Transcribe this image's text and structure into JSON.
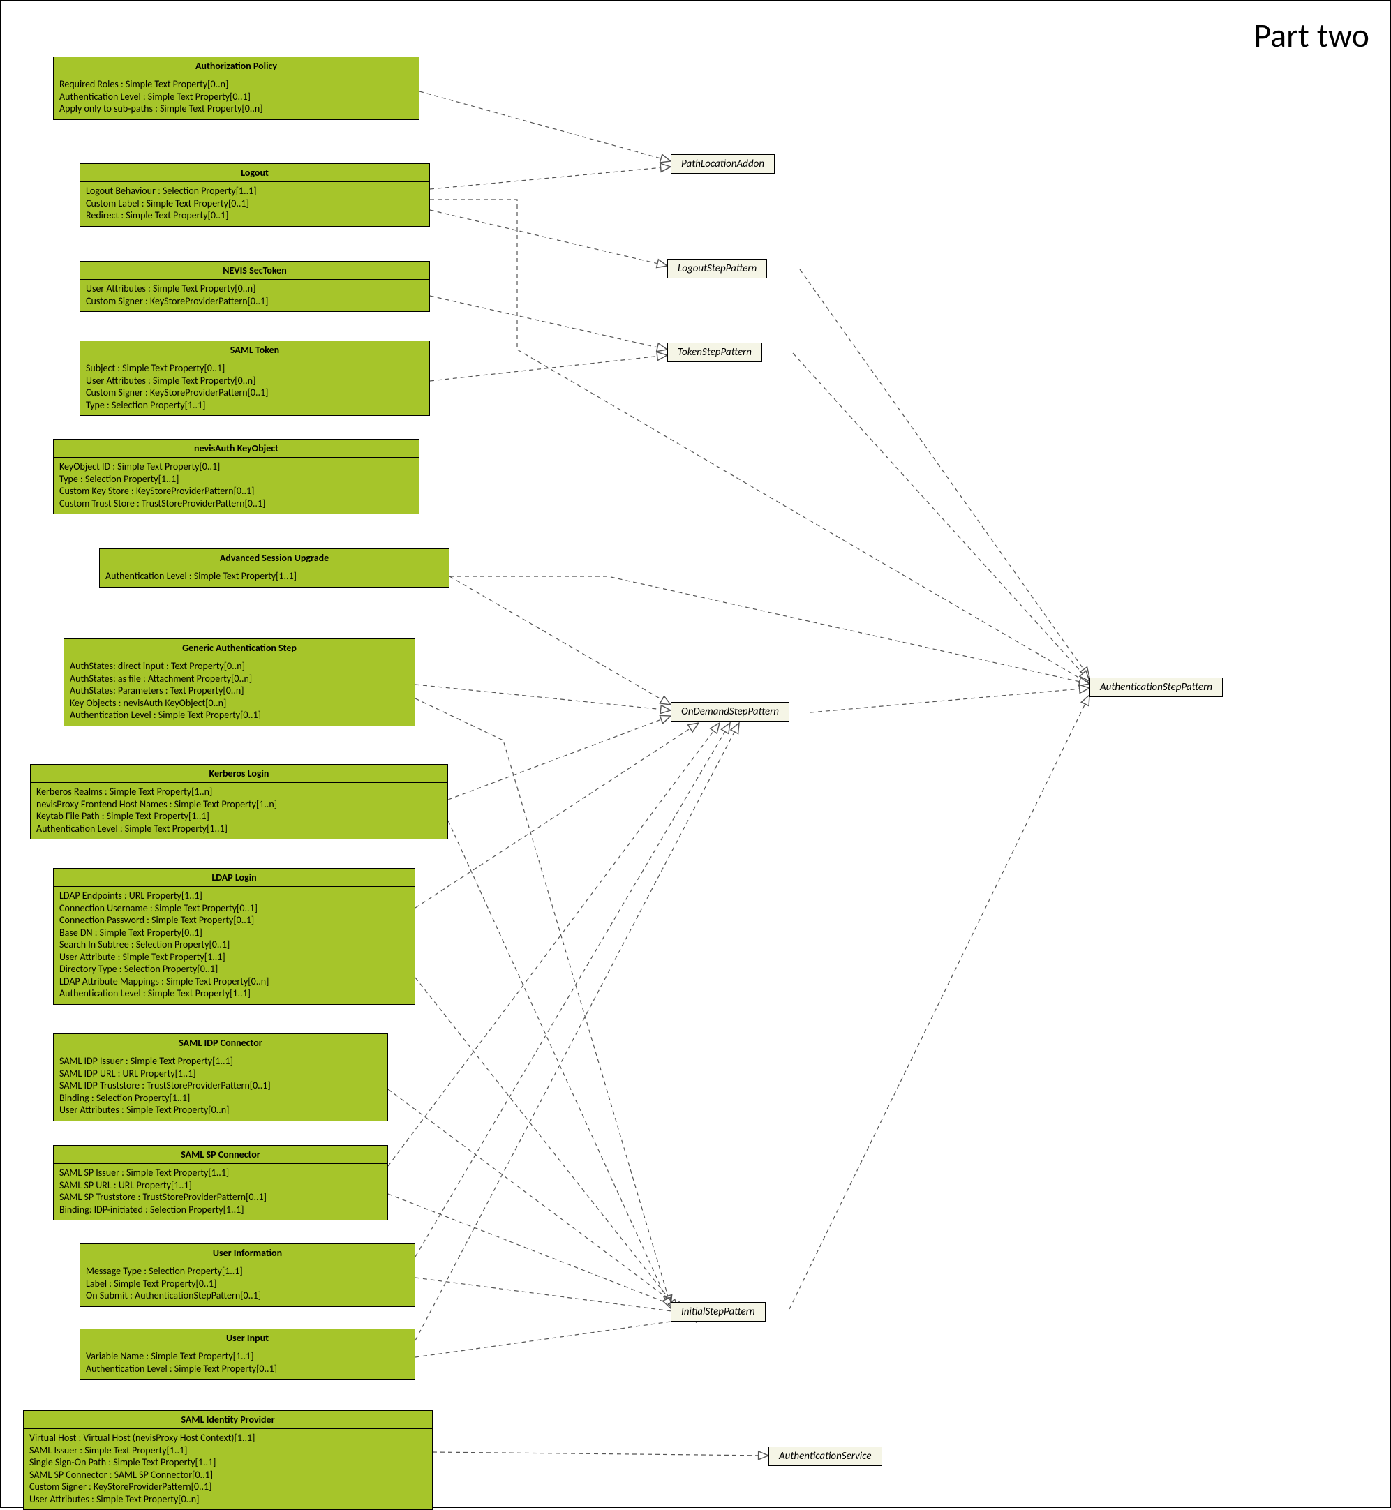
{
  "page_title": "Part two",
  "interfaces": {
    "pathLocation": "PathLocationAddon",
    "logoutStep": "LogoutStepPattern",
    "tokenStep": "TokenStepPattern",
    "onDemandStep": "OnDemandStepPattern",
    "authStep": "AuthenticationStepPattern",
    "initialStep": "InitialStepPattern",
    "authService": "AuthenticationService"
  },
  "classes": {
    "authPolicy": {
      "name": "Authorization Policy",
      "attrs": [
        "Required Roles : Simple Text Property[0..n]",
        "Authentication Level : Simple Text Property[0..1]",
        "Apply only to sub-paths : Simple Text Property[0..n]"
      ]
    },
    "logout": {
      "name": "Logout",
      "attrs": [
        "Logout Behaviour : Selection Property[1..1]",
        "Custom Label : Simple Text Property[0..1]",
        "Redirect : Simple Text Property[0..1]"
      ]
    },
    "nevisSecToken": {
      "name": "NEVIS SecToken",
      "attrs": [
        "User Attributes : Simple Text Property[0..n]",
        "Custom Signer : KeyStoreProviderPattern[0..1]"
      ]
    },
    "samlToken": {
      "name": "SAML Token",
      "attrs": [
        "Subject : Simple Text Property[0..1]",
        "User Attributes : Simple Text Property[0..n]",
        "Custom Signer : KeyStoreProviderPattern[0..1]",
        "Type : Selection Property[1..1]"
      ]
    },
    "nevisAuthKeyObject": {
      "name": "nevisAuth KeyObject",
      "attrs": [
        "KeyObject ID : Simple Text Property[0..1]",
        "Type : Selection Property[1..1]",
        "Custom Key Store : KeyStoreProviderPattern[0..1]",
        "Custom Trust Store : TrustStoreProviderPattern[0..1]"
      ]
    },
    "advSessionUpgrade": {
      "name": "Advanced Session Upgrade",
      "attrs": [
        "Authentication Level : Simple Text Property[1..1]"
      ]
    },
    "genericAuthStep": {
      "name": "Generic Authentication Step",
      "attrs": [
        "AuthStates: direct input : Text Property[0..n]",
        "AuthStates: as file : Attachment Property[0..n]",
        "AuthStates: Parameters : Text Property[0..n]",
        "Key Objects : nevisAuth KeyObject[0..n]",
        "Authentication Level : Simple Text Property[0..1]"
      ]
    },
    "kerberosLogin": {
      "name": "Kerberos Login",
      "attrs": [
        "Kerberos Realms : Simple Text Property[1..n]",
        "nevisProxy Frontend Host Names : Simple Text Property[1..n]",
        "Keytab File Path : Simple Text Property[1..1]",
        "Authentication Level : Simple Text Property[1..1]"
      ]
    },
    "ldapLogin": {
      "name": "LDAP Login",
      "attrs": [
        "LDAP Endpoints : URL Property[1..1]",
        "Connection Username : Simple Text Property[0..1]",
        "Connection Password : Simple Text Property[0..1]",
        "Base DN : Simple Text Property[0..1]",
        "Search In Subtree : Selection Property[0..1]",
        "User Attribute : Simple Text Property[1..1]",
        "Directory Type : Selection Property[0..1]",
        "LDAP Attribute Mappings : Simple Text Property[0..n]",
        "Authentication Level : Simple Text Property[1..1]"
      ]
    },
    "samlIdpConnector": {
      "name": "SAML IDP Connector",
      "attrs": [
        "SAML IDP Issuer : Simple Text Property[1..1]",
        "SAML IDP URL : URL Property[1..1]",
        "SAML IDP Truststore : TrustStoreProviderPattern[0..1]",
        "Binding : Selection Property[1..1]",
        "User Attributes : Simple Text Property[0..n]"
      ]
    },
    "samlSpConnector": {
      "name": "SAML SP Connector",
      "attrs": [
        "SAML SP Issuer : Simple Text Property[1..1]",
        "SAML SP URL : URL Property[1..1]",
        "SAML SP Truststore : TrustStoreProviderPattern[0..1]",
        "Binding: IDP-initiated : Selection Property[1..1]"
      ]
    },
    "userInformation": {
      "name": "User Information",
      "attrs": [
        "Message Type : Selection Property[1..1]",
        "Label : Simple Text Property[0..1]",
        "On Submit : AuthenticationStepPattern[0..1]"
      ]
    },
    "userInput": {
      "name": "User Input",
      "attrs": [
        "Variable Name : Simple Text Property[1..1]",
        "Authentication Level : Simple Text Property[0..1]"
      ]
    },
    "samlIdentityProvider": {
      "name": "SAML Identity Provider",
      "attrs": [
        "Virtual Host : Virtual Host (nevisProxy Host Context)[1..1]",
        "SAML Issuer : Simple Text Property[1..1]",
        "Single Sign-On Path : Simple Text Property[1..1]",
        "SAML SP Connector : SAML SP Connector[0..1]",
        "Custom Signer : KeyStoreProviderPattern[0..1]",
        "User Attributes : Simple Text Property[0..n]"
      ]
    }
  }
}
